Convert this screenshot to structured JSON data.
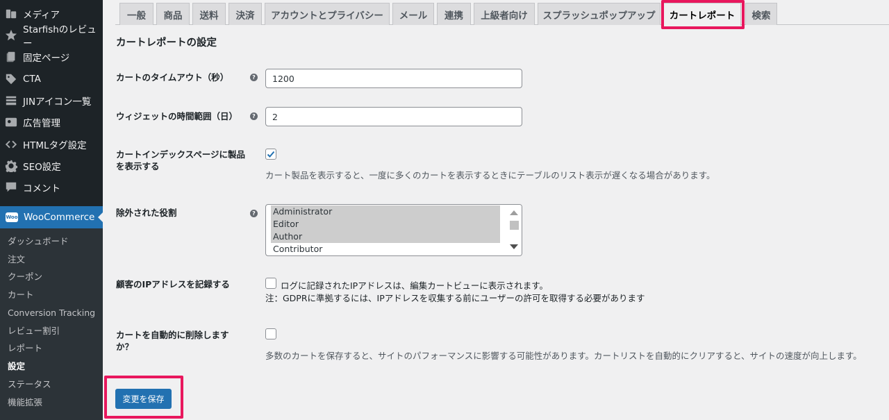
{
  "sidebar": {
    "items": [
      {
        "label": "メディア",
        "icon": "media-icon"
      },
      {
        "label": "Starfishのレビュー",
        "icon": "star-icon"
      },
      {
        "label": "固定ページ",
        "icon": "page-icon"
      },
      {
        "label": "CTA",
        "icon": "tag-icon"
      },
      {
        "label": "JINアイコン一覧",
        "icon": "list-icon"
      },
      {
        "label": "広告管理",
        "icon": "ad-icon"
      },
      {
        "label": "HTMLタグ設定",
        "icon": "code-icon"
      },
      {
        "label": "SEO設定",
        "icon": "gear-icon"
      },
      {
        "label": "コメント",
        "icon": "comment-icon"
      }
    ],
    "woocommerce": {
      "label": "WooCommerce",
      "logo": "Woo"
    },
    "submenu": [
      "ダッシュボード",
      "注文",
      "クーポン",
      "カート",
      "Conversion Tracking",
      "レビュー割引",
      "レポート",
      "設定",
      "ステータス",
      "機能拡張"
    ],
    "current_submenu": "設定"
  },
  "tabs": [
    "一般",
    "商品",
    "送料",
    "決済",
    "アカウントとプライバシー",
    "メール",
    "連携",
    "上級者向け",
    "スプラッシュポップアップ",
    "カートレポート",
    "検索"
  ],
  "active_tab": "カートレポート",
  "page_title": "カートレポートの設定",
  "fields": {
    "timeout": {
      "label": "カートのタイムアウト（秒）",
      "value": "1200"
    },
    "widget_range": {
      "label": "ウィジェットの時間範囲（日）",
      "value": "2"
    },
    "show_products": {
      "label": "カートインデックスページに製品を表示する",
      "checked": true,
      "description": "カート製品を表示すると、一度に多くのカートを表示するときにテーブルのリスト表示が遅くなる場合があります。"
    },
    "excluded_roles": {
      "label": "除外された役割",
      "options": [
        {
          "label": "Administrator",
          "selected": true
        },
        {
          "label": "Editor",
          "selected": true
        },
        {
          "label": "Author",
          "selected": true
        },
        {
          "label": "Contributor",
          "selected": false
        }
      ]
    },
    "record_ip": {
      "label": "顧客のIPアドレスを記録する",
      "checked": false,
      "inline": "ログに記録されたIPアドレスは、編集カートビューに表示されます。",
      "note": "注：GDPRに準拠するには、IPアドレスを収集する前にユーザーの許可を取得する必要があります"
    },
    "auto_delete": {
      "label": "カートを自動的に削除しますか？",
      "checked": false,
      "description": "多数のカートを保存すると、サイトのパフォーマンスに影響する可能性があります。カートリストを自動的にクリアすると、サイトの速度が向上します。"
    }
  },
  "save_label": "変更を保存",
  "colors": {
    "sidebar_bg": "#1d2327",
    "submenu_bg": "#2c3338",
    "accent": "#2271b1",
    "highlight": "#e8175d"
  }
}
